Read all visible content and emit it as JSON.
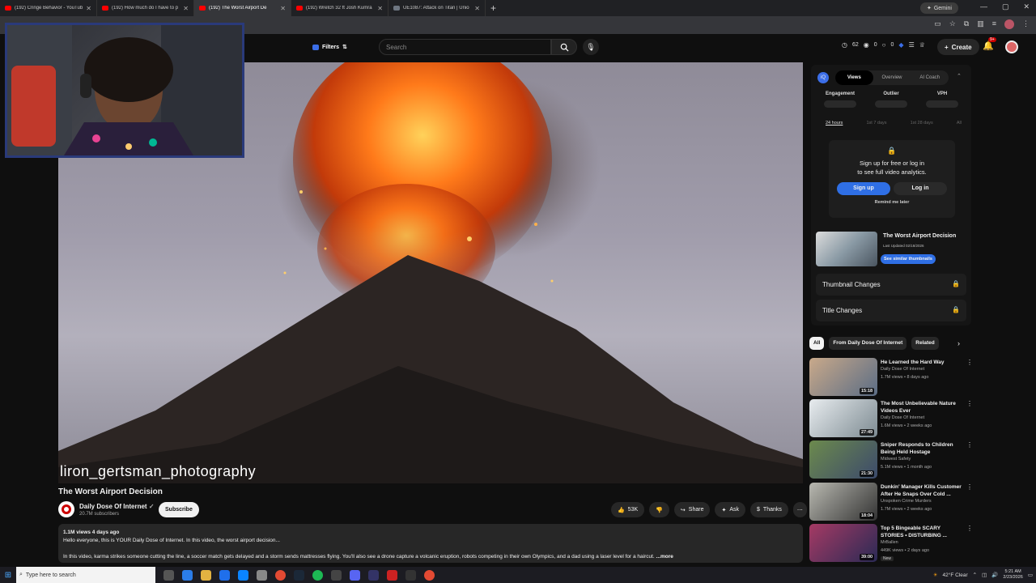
{
  "browser": {
    "tabs": [
      {
        "label": "(192) Cringe Behavior - YouTub",
        "active": false
      },
      {
        "label": "(192) How much do I have to p",
        "active": false
      },
      {
        "label": "(192) The Worst Airport De",
        "active": true
      },
      {
        "label": "(192) Wretch 32 ft Josh Kumra",
        "active": false
      },
      {
        "label": "UE1087: Attack on Titan | Unio",
        "active": false
      }
    ],
    "new_tab": "+",
    "gemini_label": "Gemini"
  },
  "header": {
    "filters_label": "Filters",
    "search_placeholder": "Search",
    "stats": {
      "a": "62",
      "b": "0",
      "c": "0"
    },
    "create_label": "Create",
    "notif_badge": "9+"
  },
  "video": {
    "watermark": "liron_gertsman_photography",
    "title": "The Worst Airport Decision",
    "channel": "Daily Dose Of Internet",
    "subscribers": "20.7M subscribers",
    "subscribe_label": "Subscribe",
    "likes": "53K",
    "share_label": "Share",
    "ask_label": "Ask",
    "thanks_label": "Thanks",
    "meta": "1.1M views  4 days ago",
    "desc_line1": "Hello everyone, this is YOUR Daily Dose of Internet. In this video, the worst airport decision...",
    "desc_line2": "In this video, karma strikes someone cutting the line, a soccer match gets delayed and a storm sends mattresses flying. You'll also see a drone capture a volcanic eruption, robots competing in their own Olympics, and a dad using a laser level for a haircut.",
    "more_label": "...more"
  },
  "analytics": {
    "tabs": [
      "Views",
      "Overview",
      "AI Coach"
    ],
    "metrics": [
      "Engagement",
      "Outlier",
      "VPH"
    ],
    "ranges": [
      "24 hours",
      "1st 7 days",
      "1st 28 days",
      "All"
    ],
    "lock_line1": "Sign up for free or log in",
    "lock_line2": "to see full video analytics.",
    "signup_label": "Sign up",
    "login_label": "Log in",
    "remind_label": "Remind me later",
    "thumb_title": "The Worst Airport Decision",
    "thumb_updated": "Last Updated 02/18/2026",
    "similar_label": "See similar thumbnails",
    "thumbnail_changes": "Thumbnail Changes",
    "title_changes": "Title Changes"
  },
  "chips": [
    "All",
    "From Daily Dose Of Internet",
    "Related"
  ],
  "recommendations": [
    {
      "title": "He Learned the Hard Way",
      "channel": "Daily Dose Of Internet",
      "views": "1.7M views • 8 days ago",
      "duration": "15:18",
      "colors": [
        "#c9a98a",
        "#5b6d85"
      ]
    },
    {
      "title": "The Most Unbelievable Nature Videos Ever",
      "channel": "Daily Dose Of Internet",
      "views": "1.6M views • 2 weeks ago",
      "duration": "27:49",
      "colors": [
        "#e8ecef",
        "#7d8b92"
      ]
    },
    {
      "title": "Sniper Responds to Children Being Held Hostage",
      "channel": "Midwest Safety",
      "views": "5.1M views • 1 month ago",
      "duration": "21:30",
      "colors": [
        "#6c8a4d",
        "#3c4a6b"
      ]
    },
    {
      "title": "Dunkin' Manager Kills Customer After He Snaps Over Cold ...",
      "channel": "Unspoken Crime Murders",
      "views": "1.7M views • 2 weeks ago",
      "duration": "18:04",
      "colors": [
        "#b8b8b0",
        "#333333"
      ]
    },
    {
      "title": "Top 5 Bingeable SCARY STORIES • DISTURBING ...",
      "channel": "MrBallen",
      "views": "449K views • 2 days ago",
      "duration": "39:00",
      "new": "New",
      "colors": [
        "#a53a64",
        "#2a2a55"
      ]
    }
  ],
  "taskbar": {
    "search_placeholder": "Type here to search",
    "weather": "42°F  Clear",
    "time": "5:21 AM",
    "date": "2/23/2026"
  }
}
